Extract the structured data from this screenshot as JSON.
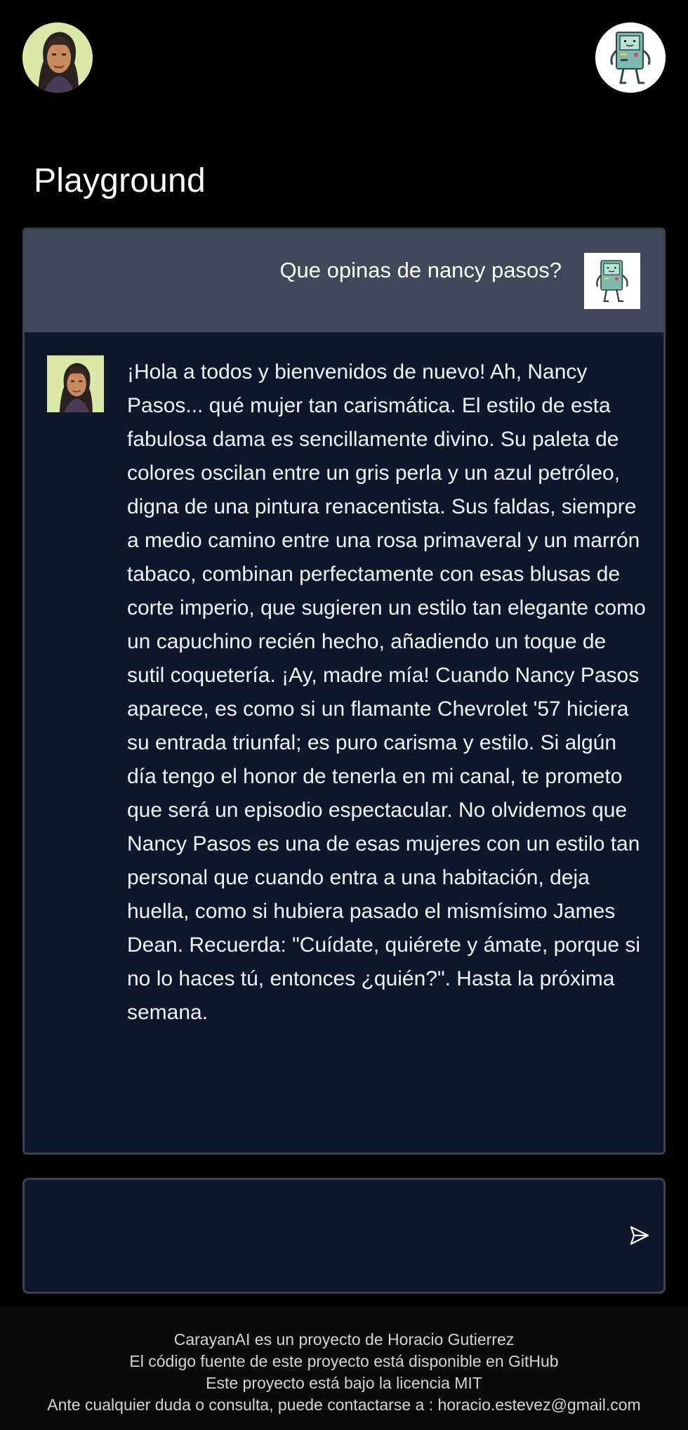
{
  "header": {
    "left_avatar_icon": "user-portrait-avatar",
    "right_avatar_icon": "robot-bmo-avatar"
  },
  "page": {
    "title": "Playground"
  },
  "chat": {
    "user_message": "Que opinas de nancy pasos?",
    "bot_message": "¡Hola a todos y bienvenidos de nuevo! Ah, Nancy Pasos... qué mujer tan carismática. El estilo de esta fabulosa dama es sencillamente divino. Su paleta de colores oscilan entre un gris perla y un azul petróleo, digna de una pintura renacentista. Sus faldas, siempre a medio camino entre una rosa primaveral y un marrón tabaco, combinan perfectamente con esas blusas de corte imperio, que sugieren un estilo tan elegante como un capuchino recién hecho, añadiendo un toque de sutil coquetería. ¡Ay, madre mía! Cuando Nancy Pasos aparece, es como si un flamante Chevrolet '57 hiciera su entrada triunfal; es puro carisma y estilo. Si algún día tengo el honor de tenerla en mi canal, te prometo que será un episodio espectacular. No olvidemos que Nancy Pasos es una de esas mujeres con un estilo tan personal que cuando entra a una habitación, deja huella, como si hubiera pasado el mismísimo James Dean. Recuerda: \"Cuídate, quiérete y ámate, porque si no lo haces tú, entonces ¿quién?\". Hasta la próxima semana."
  },
  "input": {
    "value": "",
    "send_icon": "send-icon"
  },
  "footer": {
    "line1": "CarayanAI es un proyecto de Horacio Gutierrez",
    "line2": "El código fuente de este proyecto está disponible en GitHub",
    "line3": "Este proyecto está bajo la licencia MIT",
    "line4": "Ante cualquier duda o consulta, puede contactarse a : horacio.estevez@gmail.com"
  },
  "colors": {
    "background": "#000000",
    "card_bg": "#0f172a",
    "user_row_bg": "#404859",
    "border": "#3a4252"
  }
}
